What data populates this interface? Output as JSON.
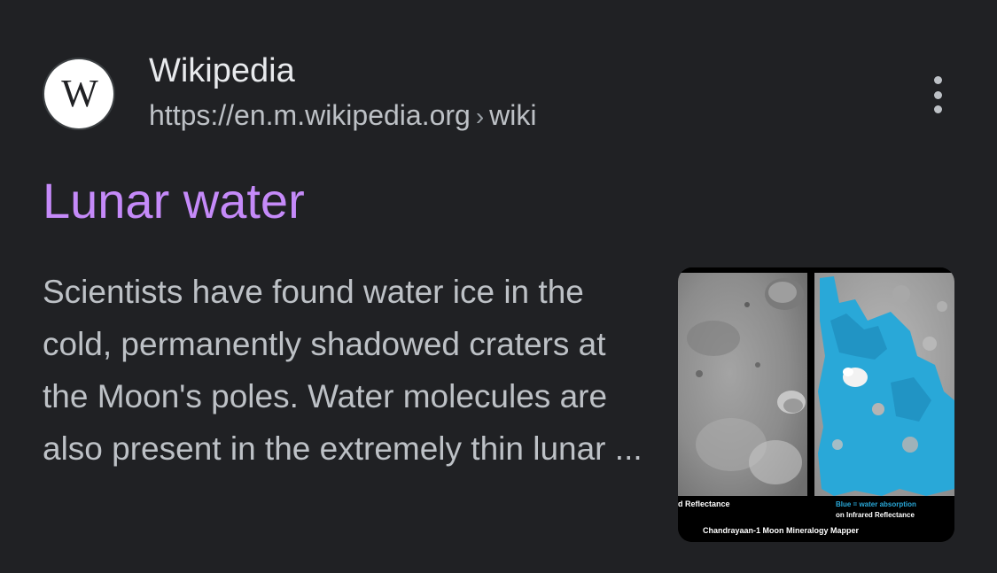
{
  "source": {
    "favicon_letter": "W",
    "site_name": "Wikipedia",
    "url_base": "https://en.m.wikipedia.org",
    "url_separator": "›",
    "url_path": "wiki"
  },
  "menu": {
    "icon": "more-vert-icon"
  },
  "result": {
    "title": "Lunar water",
    "snippet": "Scientists have found water ice in the cold, permanently shadowed craters at the Moon's poles. Water molecules are also present in the extremely thin lunar ..."
  },
  "thumbnail": {
    "left_caption": "d Reflectance",
    "right_caption_line1": "Blue    = water absorption",
    "right_caption_line2": "on Infrared Reflectance",
    "bottom_caption": "Chandrayaan-1   Moon Mineralogy Mapper"
  },
  "colors": {
    "background": "#202124",
    "title_visited": "#c58af9",
    "snippet_text": "#bdc1c6",
    "water_blue": "#29a8d8"
  }
}
